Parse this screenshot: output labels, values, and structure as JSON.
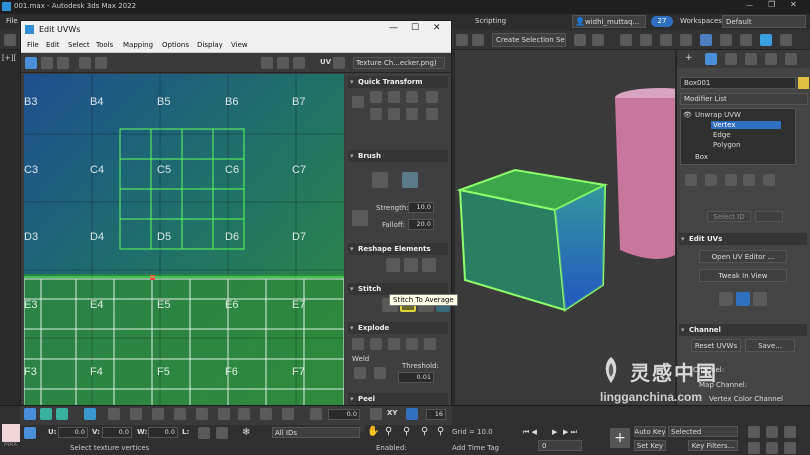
{
  "max_window": {
    "title": "001.max - Autodesk 3ds Max 2022",
    "menu_file": "File",
    "menu_scripting": "Scripting",
    "user": "widhi_muttaq...",
    "notifications": "27",
    "workspaces_label": "Workspaces:",
    "workspaces_value": "Default",
    "selection_set_placeholder": "Create Selection Se",
    "viewport_label": "[+][",
    "frame_label": "MAX"
  },
  "uvw_window": {
    "title": "Edit UVWs",
    "menus": [
      "File",
      "Edit",
      "Select",
      "Tools",
      "Mapping",
      "Options",
      "Display",
      "View"
    ],
    "uv_label": "UV",
    "texture_dropdown": "Texture Ch...ecker.png)",
    "grid_labels": [
      "B3",
      "B4",
      "B5",
      "B6",
      "B7",
      "C3",
      "C4",
      "C5",
      "C6",
      "C7",
      "D3",
      "D4",
      "D5",
      "D6",
      "D7",
      "E3",
      "E4",
      "E5",
      "E6",
      "E7",
      "F3",
      "F4",
      "F5",
      "F6",
      "F7"
    ],
    "tooltip": "Stitch To Average",
    "quick_transform_title": "Quick Transform",
    "brush_title": "Brush",
    "strength_label": "Strength:",
    "strength_value": "10.0",
    "falloff_label": "Falloff:",
    "falloff_value": "20.0",
    "reshape_title": "Reshape Elements",
    "stitch_title": "Stitch",
    "explode_title": "Explode",
    "weld_label": "Weld",
    "threshold_label": "Threshold:",
    "threshold_value": "0.01",
    "peel_title": "Peel",
    "bottom": {
      "u_label": "U:",
      "u_value": "0.0",
      "v_label": "V:",
      "v_value": "0.0",
      "w_label": "W:",
      "w_value": "0.0",
      "l_label": "L:",
      "ids_value": "All IDs",
      "xy_label": "XY",
      "spin_value": "0.0",
      "size_value": "16"
    }
  },
  "command_panel": {
    "object_name": "Box001",
    "modifier_list": "Modifier List",
    "modifier_stack": [
      "Unwrap UVW",
      "Vertex",
      "Edge",
      "Polygon",
      "Box"
    ],
    "select_id": "Select ID",
    "edit_uvs_title": "Edit UVs",
    "open_uv_editor": "Open UV Editor ...",
    "tweak_in_view": "Tweak In View",
    "channel_title": "Channel",
    "reset_uvws": "Reset UVWs",
    "save": "Save...",
    "channel_label": "Channel:",
    "map_channel": "Map Channel:",
    "vertex_color_channel": "Vertex Color Channel"
  },
  "status": {
    "select_text": "Select texture vertices",
    "grid_text": "Grid = 10.0",
    "add_time_tag": "Add Time Tag",
    "enabled_label": "Enabled:",
    "auto_key": "Auto Key",
    "set_key": "Set Key",
    "selected_value": "Selected",
    "key_filters": "Key Filters...",
    "frame_value": "0"
  },
  "watermark": {
    "text": "lingganchina.com",
    "logo_chars": "灵感中国"
  },
  "colors": {
    "uv_green": "#33ff33",
    "accent_blue": "#2f6fbf",
    "uvw_titlebar": "#f0f0f0"
  }
}
